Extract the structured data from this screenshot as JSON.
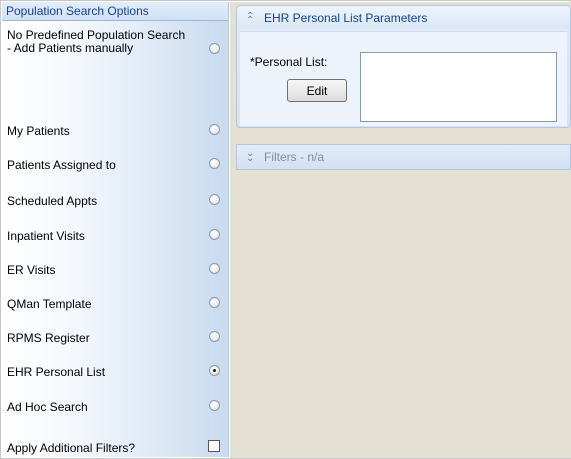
{
  "left_panel": {
    "title": "Population Search Options",
    "options": [
      {
        "label": "No Predefined Population Search - Add Patients manually",
        "checked": false
      },
      {
        "label": "My Patients",
        "checked": false
      },
      {
        "label": "Patients Assigned to",
        "checked": false
      },
      {
        "label": "Scheduled Appts",
        "checked": false
      },
      {
        "label": "Inpatient Visits",
        "checked": false
      },
      {
        "label": "ER Visits",
        "checked": false
      },
      {
        "label": "QMan Template",
        "checked": false
      },
      {
        "label": "RPMS Register",
        "checked": false
      },
      {
        "label": "EHR Personal List",
        "checked": true
      },
      {
        "label": "Ad Hoc Search",
        "checked": false
      }
    ],
    "apply_filters": {
      "label": "Apply Additional Filters?",
      "checked": false
    }
  },
  "params_panel": {
    "title": "EHR Personal List Parameters",
    "personal_list_label": "*Personal List:",
    "edit_label": "Edit",
    "personal_list_value": ""
  },
  "filters_panel": {
    "title": "Filters - n/a"
  },
  "icons": {
    "collapse": "chevron-double-up-icon",
    "expand": "chevron-double-down-icon"
  },
  "colors": {
    "header_text": "#15428b",
    "disabled_text": "#7f8fa6",
    "workspace": "#e4e0d2"
  }
}
